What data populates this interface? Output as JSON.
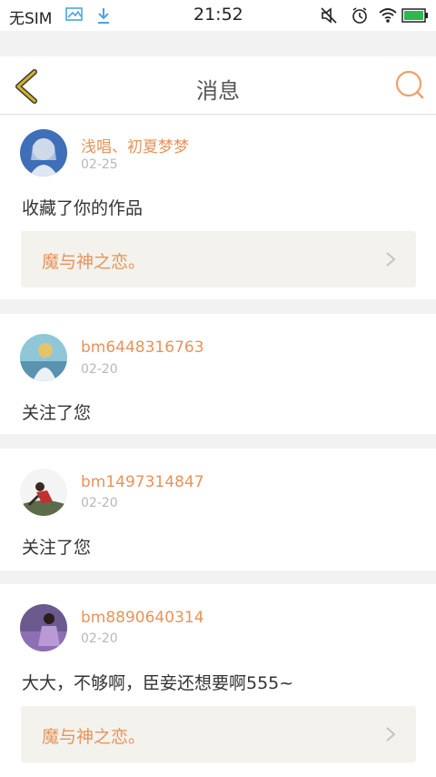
{
  "status_bar": {
    "carrier": "无SIM",
    "time": "21:52",
    "icons": [
      "image-icon",
      "download-icon",
      "mute-icon",
      "alarm-icon",
      "wifi-icon",
      "battery-icon"
    ]
  },
  "header": {
    "title": "消息",
    "back_icon": "chevron-left-icon",
    "search_icon": "search-icon"
  },
  "colors": {
    "accent": "#e8935a",
    "back_arrow": "#d4b224",
    "card_bg": "#ffffff",
    "page_bg": "#f2f2f2",
    "work_bg": "#f3f2ec"
  },
  "messages": [
    {
      "username": "浅唱、初夏梦梦",
      "date": "02-25",
      "text": "收藏了你的作品",
      "work_title": "魔与神之恋。"
    },
    {
      "username": "bm6448316763",
      "date": "02-20",
      "text": "关注了您"
    },
    {
      "username": "bm1497314847",
      "date": "02-20",
      "text": "关注了您"
    },
    {
      "username": "bm8890640314",
      "date": "02-20",
      "text": "大大，不够啊，臣妾还想要啊555~",
      "work_title": "魔与神之恋。"
    }
  ]
}
